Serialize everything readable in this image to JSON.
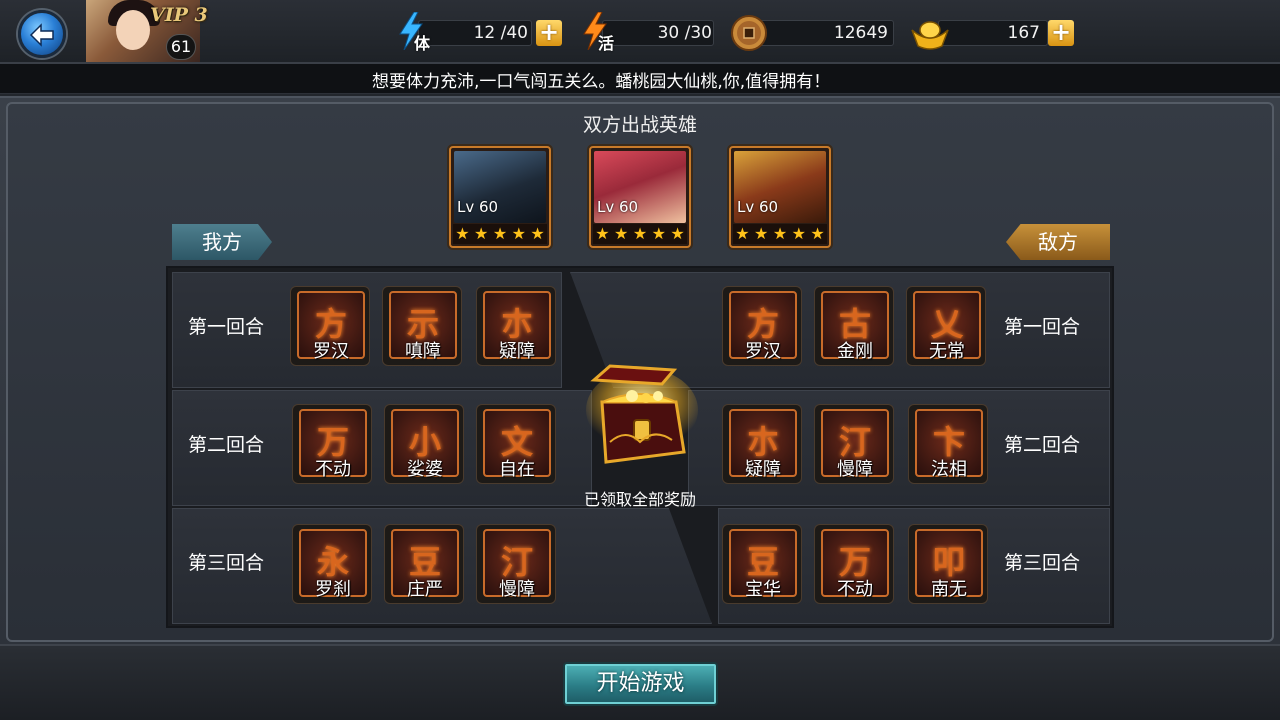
{
  "header": {
    "vip_label": "VIP 3",
    "player_level": "61",
    "stamina": {
      "tag": "体",
      "value": "12 /40"
    },
    "vitality": {
      "tag": "活",
      "value": "30 /30"
    },
    "coins": {
      "value": "12649"
    },
    "gold": {
      "value": "167"
    },
    "plus_label": "+"
  },
  "marquee": {
    "text": "想要体力充沛,一口气闯五关么。蟠桃园大仙桃,你,值得拥有！"
  },
  "battle": {
    "title": "双方出战英雄",
    "my_side": "我方",
    "enemy_side": "敌方",
    "heroes": [
      {
        "level": "Lv 60",
        "stars": 5
      },
      {
        "level": "Lv 60",
        "stars": 5
      },
      {
        "level": "Lv 60",
        "stars": 5
      }
    ],
    "rounds": [
      {
        "label": "第一回合",
        "my_skills": [
          {
            "name": "罗汉",
            "glyph": "方"
          },
          {
            "name": "嗔障",
            "glyph": "示"
          },
          {
            "name": "疑障",
            "glyph": "朩"
          }
        ],
        "enemy_skills": [
          {
            "name": "罗汉",
            "glyph": "方"
          },
          {
            "name": "金刚",
            "glyph": "古"
          },
          {
            "name": "无常",
            "glyph": "乂"
          }
        ]
      },
      {
        "label": "第二回合",
        "my_skills": [
          {
            "name": "不动",
            "glyph": "万"
          },
          {
            "name": "娑婆",
            "glyph": "小"
          },
          {
            "name": "自在",
            "glyph": "文"
          }
        ],
        "enemy_skills": [
          {
            "name": "疑障",
            "glyph": "朩"
          },
          {
            "name": "慢障",
            "glyph": "汀"
          },
          {
            "name": "法相",
            "glyph": "卞"
          }
        ]
      },
      {
        "label": "第三回合",
        "my_skills": [
          {
            "name": "罗刹",
            "glyph": "永"
          },
          {
            "name": "庄严",
            "glyph": "豆"
          },
          {
            "name": "慢障",
            "glyph": "汀"
          }
        ],
        "enemy_skills": [
          {
            "name": "宝华",
            "glyph": "豆"
          },
          {
            "name": "不动",
            "glyph": "万"
          },
          {
            "name": "南无",
            "glyph": "叩"
          }
        ]
      }
    ],
    "reward_label": "已领取全部奖励"
  },
  "footer": {
    "start_label": "开始游戏"
  },
  "colors": {
    "skill_frame": "#c86b2a",
    "skill_glyph": "#d8661e",
    "teal_button": "#2b7d86",
    "gold_plus": "#ffb21a"
  },
  "icons": [
    "back-arrow-icon",
    "lightning-icon",
    "fire-icon",
    "coin-icon",
    "gold-ingot-icon",
    "plus-icon",
    "star-icon",
    "treasure-chest-icon"
  ]
}
